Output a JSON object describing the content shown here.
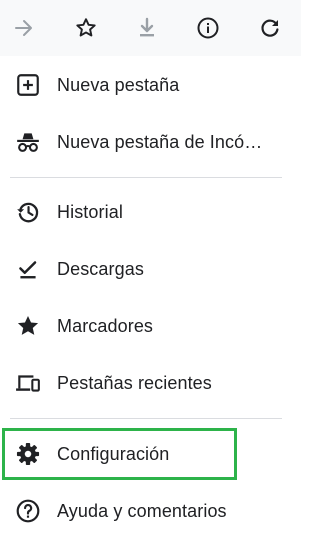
{
  "toolbar": {
    "buttons": [
      {
        "icon": "arrow-forward-icon",
        "enabled": false
      },
      {
        "icon": "star-outline-icon",
        "enabled": true
      },
      {
        "icon": "download-icon",
        "enabled": false
      },
      {
        "icon": "info-icon",
        "enabled": true
      },
      {
        "icon": "refresh-icon",
        "enabled": true
      }
    ]
  },
  "menu": {
    "items": [
      {
        "label": "Nueva pestaña",
        "icon": "add-box-icon"
      },
      {
        "label": "Nueva pestaña de Incó…",
        "icon": "incognito-icon"
      },
      {
        "label": "Historial",
        "icon": "history-icon"
      },
      {
        "label": "Descargas",
        "icon": "download-done-icon"
      },
      {
        "label": "Marcadores",
        "icon": "star-filled-icon"
      },
      {
        "label": "Pestañas recientes",
        "icon": "devices-icon"
      },
      {
        "label": "Configuración",
        "icon": "settings-gear-icon",
        "highlighted": true
      },
      {
        "label": "Ayuda y comentarios",
        "icon": "help-icon"
      }
    ]
  },
  "colors": {
    "highlight_border": "#2db34a",
    "icon": "#202124",
    "icon_disabled": "#9aa0a6",
    "toolbar_bg": "#f8f9fa",
    "divider": "#dadce0"
  }
}
